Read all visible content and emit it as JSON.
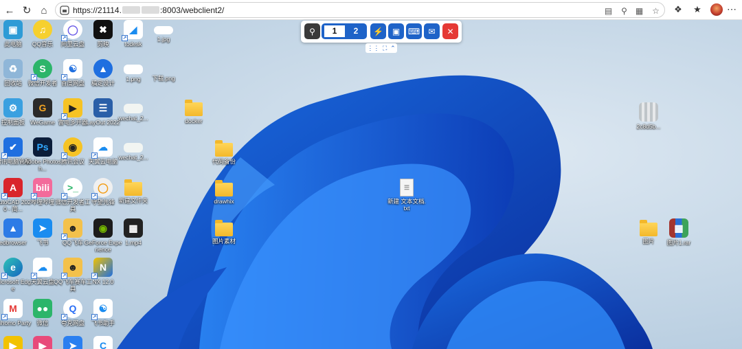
{
  "browser": {
    "url_prefix": "https://21114.",
    "url_suffix": ":8003/webclient2/"
  },
  "remote_toolbar": {
    "page_current": "1",
    "page_other": "2"
  },
  "desktop_icons": {
    "col1": [
      "此电脑",
      "回收站",
      "控制面板",
      "腾讯电脑管家",
      "AutoCAD 2020 - 简...",
      "edbrowser",
      "Microsoft Edge",
      "Mihomo Party"
    ],
    "col2": [
      "QQ音乐",
      "微信开发者",
      "WeGame",
      "Adobe Photosh...",
      "哔哩哔哩",
      "飞书",
      "天翼云盘",
      "微信"
    ],
    "col3": [
      "阿里云盘",
      "百度网盘",
      "雷电多开器",
      "腾讯会议",
      "微信开发者工具",
      "QQ飞车",
      "QQ飞车赛车工具",
      "夸克网盘"
    ],
    "col4": [
      "剪映",
      "稿定设计",
      "LayOut 2022",
      "天翼云电脑",
      "守望先锋",
      "GeForce Experience",
      "NX 12.0",
      "飞书助手"
    ],
    "col5": [
      "todesk",
      "1.png",
      "wechat_2...",
      "wechat_2...",
      "新建文件夹",
      "1.mp4"
    ],
    "col6": [
      "1.jpg",
      "下载.png"
    ],
    "folders": [
      "docker",
      "代码备份",
      "drawhix",
      "图片素材"
    ],
    "text_file": "新建 文本文档.txt",
    "right_folder": "图片",
    "right_rar": "图片1.rar",
    "right_image": "2c8d5b..."
  },
  "colors": {
    "accent": "#1e63c8",
    "close": "#e53935",
    "pin": "#3a3a3a"
  }
}
